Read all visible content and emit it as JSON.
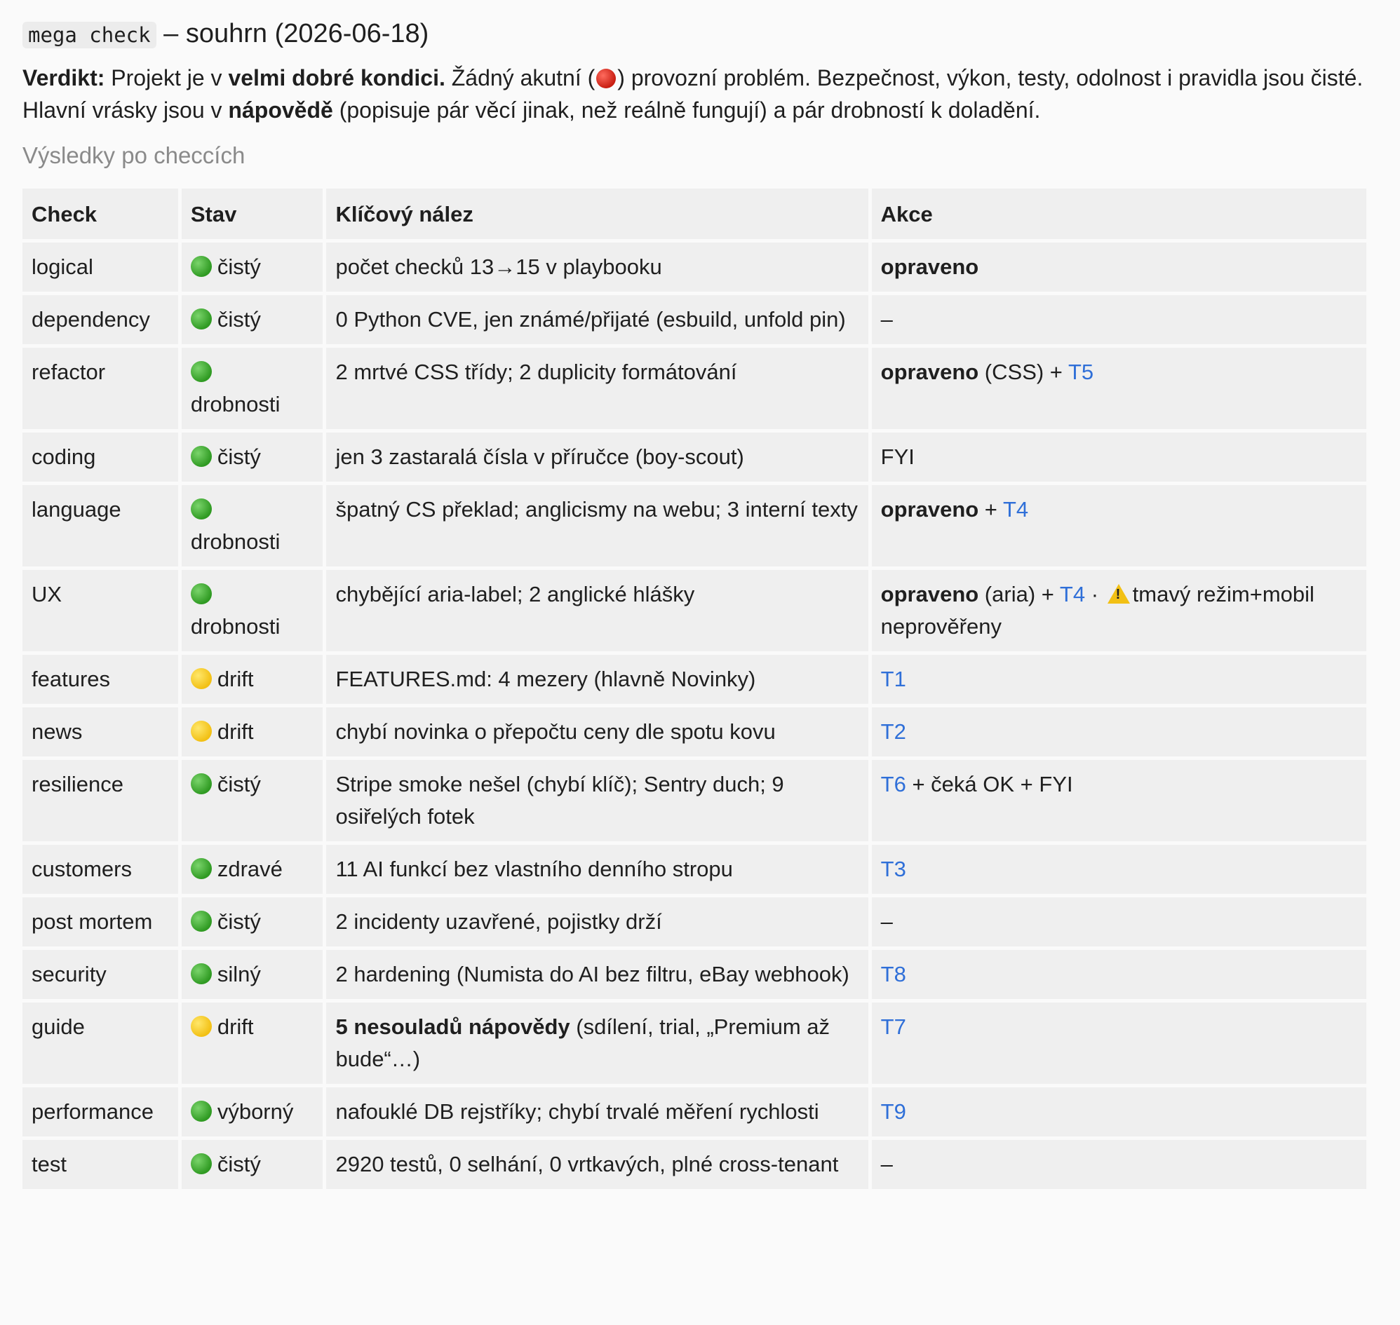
{
  "header": {
    "code": "mega check",
    "title_rest": " – souhrn (2026-06-18)"
  },
  "verdict": {
    "label": "Verdikt:",
    "t1": " Projekt je v ",
    "b1": "velmi dobré kondici.",
    "t2": " Žádný akutní (",
    "t3": ") provozní problém. Bezpečnost, výkon, testy, odolnost i pravidla jsou čisté. Hlavní vrásky jsou v ",
    "b2": "nápovědě",
    "t4": " (popisuje pár věcí jinak, než reálně fungují) a pár drobností k doladění."
  },
  "subheading": "Výsledky po checcích",
  "table": {
    "headers": [
      "Check",
      "Stav",
      "Klíčový nález",
      "Akce"
    ],
    "rows": [
      {
        "check": "logical",
        "status_color": "green",
        "status": "čistý",
        "finding": "počet checků 13→15 v playbooku",
        "action": [
          {
            "text": "opraveno",
            "bold": true
          }
        ]
      },
      {
        "check": "dependency",
        "status_color": "green",
        "status": "čistý",
        "finding": "0 Python CVE, jen známé/přijaté (esbuild, unfold pin)",
        "action": [
          {
            "text": "–"
          }
        ]
      },
      {
        "check": "refactor",
        "status_color": "green",
        "status": "drobnosti",
        "status_break": true,
        "finding": "2 mrtvé CSS třídy; 2 duplicity formátování",
        "action": [
          {
            "text": "opraveno",
            "bold": true
          },
          {
            "text": " (CSS) + "
          },
          {
            "text": "T5",
            "link": true
          }
        ]
      },
      {
        "check": "coding",
        "status_color": "green",
        "status": "čistý",
        "finding": "jen 3 zastaralá čísla v příručce (boy-scout)",
        "action": [
          {
            "text": "FYI"
          }
        ]
      },
      {
        "check": "language",
        "status_color": "green",
        "status": "drobnosti",
        "status_break": true,
        "finding": "špatný CS překlad; anglicismy na webu; 3 interní texty",
        "action": [
          {
            "text": "opraveno",
            "bold": true
          },
          {
            "text": " + "
          },
          {
            "text": "T4",
            "link": true
          }
        ]
      },
      {
        "check": "UX",
        "status_color": "green",
        "status": "drobnosti",
        "status_break": true,
        "finding": "chybějící aria-label; 2 anglické hlášky",
        "action": [
          {
            "text": "opraveno",
            "bold": true
          },
          {
            "text": " (aria) + "
          },
          {
            "text": "T4",
            "link": true
          },
          {
            "text": " · "
          },
          {
            "warn": true
          },
          {
            "text": "tmavý režim+mobil neprověřeny"
          }
        ]
      },
      {
        "check": "features",
        "status_color": "yellow",
        "status": "drift",
        "finding": "FEATURES.md: 4 mezery (hlavně Novinky)",
        "action": [
          {
            "text": "T1",
            "link": true
          }
        ]
      },
      {
        "check": "news",
        "status_color": "yellow",
        "status": "drift",
        "finding": "chybí novinka o přepočtu ceny dle spotu kovu",
        "action": [
          {
            "text": "T2",
            "link": true
          }
        ]
      },
      {
        "check": "resilience",
        "status_color": "green",
        "status": "čistý",
        "finding": "Stripe smoke nešel (chybí klíč); Sentry duch; 9 osiřelých fotek",
        "action": [
          {
            "text": "T6",
            "link": true
          },
          {
            "text": " + čeká OK + FYI"
          }
        ]
      },
      {
        "check": "customers",
        "status_color": "green",
        "status": "zdravé",
        "finding": "11 AI funkcí bez vlastního denního stropu",
        "action": [
          {
            "text": "T3",
            "link": true
          }
        ]
      },
      {
        "check": "post mortem",
        "status_color": "green",
        "status": "čistý",
        "finding": "2 incidenty uzavřené, pojistky drží",
        "action": [
          {
            "text": "–"
          }
        ]
      },
      {
        "check": "security",
        "status_color": "green",
        "status": "silný",
        "finding": "2 hardening (Numista do AI bez filtru, eBay webhook)",
        "action": [
          {
            "text": "T8",
            "link": true
          }
        ]
      },
      {
        "check": "guide",
        "status_color": "yellow",
        "status": "drift",
        "finding_bold": "5 nesouladů nápovědy",
        "finding": " (sdílení, trial, „Premium až bude“…)",
        "action": [
          {
            "text": "T7",
            "link": true
          }
        ]
      },
      {
        "check": "performance",
        "status_color": "green",
        "status": "výborný",
        "finding": "nafouklé DB rejstříky; chybí trvalé měření rychlosti",
        "action": [
          {
            "text": "T9",
            "link": true
          }
        ]
      },
      {
        "check": "test",
        "status_color": "green",
        "status": "čistý",
        "finding": "2920 testů, 0 selhání, 0 vrtkavých, plné cross-tenant",
        "action": [
          {
            "text": "–"
          }
        ]
      }
    ]
  },
  "colors": {
    "link": "#2f6fd8",
    "cell_bg": "#efefef",
    "page_bg": "#fafafa",
    "green": "#2f9a22",
    "yellow": "#f2c014",
    "red": "#c81e12"
  },
  "icons": {
    "status_green": "green-circle-icon",
    "status_yellow": "yellow-circle-icon",
    "acute": "red-circle-icon",
    "warning": "warning-icon"
  }
}
